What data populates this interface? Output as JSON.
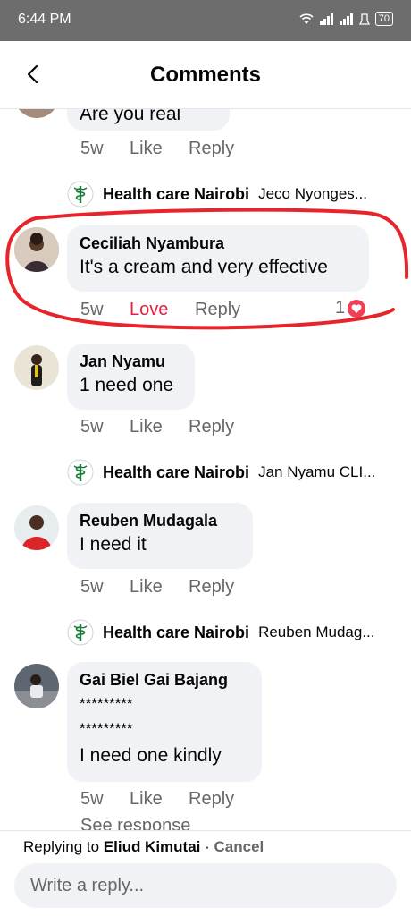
{
  "status": {
    "time": "6:44 PM",
    "battery": "70"
  },
  "header": {
    "title": "Comments"
  },
  "comments": [
    {
      "text": "Are you real",
      "age": "5w",
      "like": "Like",
      "reply": "Reply",
      "reply_preview": {
        "author": "Health care Nairobi",
        "text": "Jeco Nyonges..."
      }
    },
    {
      "author": "Ceciliah Nyambura",
      "text": "It's a cream and very effective",
      "age": "5w",
      "like": "Love",
      "reply": "Reply",
      "reactions": "1",
      "highlight_color": "#e8242b"
    },
    {
      "author": "Jan Nyamu",
      "text": "1 need one",
      "age": "5w",
      "like": "Like",
      "reply": "Reply",
      "reply_preview": {
        "author": "Health care Nairobi",
        "text": "Jan Nyamu CLI..."
      }
    },
    {
      "author": "Reuben Mudagala",
      "text": "I need it",
      "age": "5w",
      "like": "Like",
      "reply": "Reply",
      "reply_preview": {
        "author": "Health care Nairobi",
        "text": "Reuben Mudag..."
      }
    },
    {
      "author": "Gai Biel Gai Bajang",
      "lines": [
        "*********",
        "*********",
        "I need one kindly"
      ],
      "age": "5w",
      "like": "Like",
      "reply": "Reply",
      "see_response": "See response"
    }
  ],
  "footer": {
    "replying_prefix": "Replying to",
    "replying_name": "Eliud Kimutai",
    "separator": " · ",
    "cancel": "Cancel",
    "placeholder": "Write a reply..."
  },
  "colors": {
    "love": "#e41e3f",
    "highlight": "#e8242b",
    "bubble": "#f0f2f5",
    "meta": "#65676b",
    "statusbar": "#6d6d6d"
  }
}
